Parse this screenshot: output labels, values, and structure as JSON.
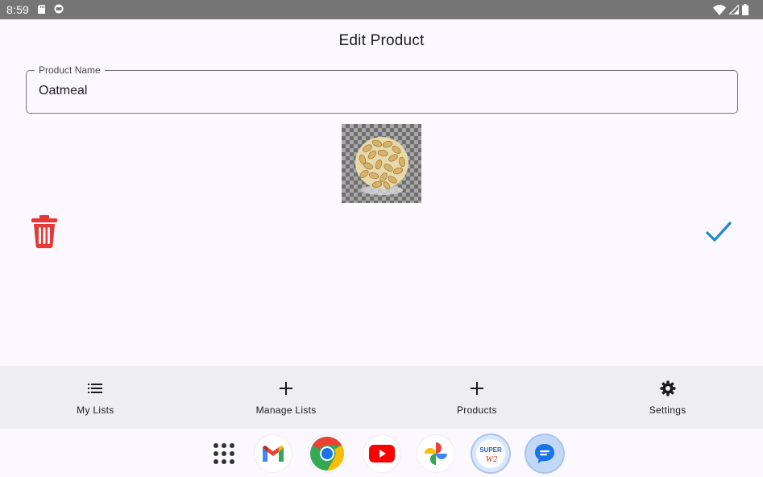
{
  "status_bar": {
    "time": "8:59"
  },
  "header": {
    "title": "Edit Product"
  },
  "form": {
    "product_name_label": "Product Name",
    "product_name_value": "Oatmeal"
  },
  "product_image": {
    "alt": "Oatmeal"
  },
  "actions": {
    "delete_icon": "trash-icon",
    "save_icon": "check-icon",
    "delete_color": "#e53935",
    "save_color": "#1e88c8"
  },
  "bottom_nav": {
    "items": [
      {
        "label": "My Lists",
        "icon": "list-icon"
      },
      {
        "label": "Manage Lists",
        "icon": "plus-icon"
      },
      {
        "label": "Products",
        "icon": "plus-icon"
      },
      {
        "label": "Settings",
        "icon": "gear-icon"
      }
    ]
  },
  "dock": {
    "apps": [
      {
        "name": "app-drawer",
        "icon": "grid-icon"
      },
      {
        "name": "gmail",
        "icon": "gmail-icon"
      },
      {
        "name": "chrome",
        "icon": "chrome-icon"
      },
      {
        "name": "youtube",
        "icon": "youtube-icon"
      },
      {
        "name": "photos",
        "icon": "photos-icon"
      },
      {
        "name": "super-w2",
        "icon": "super-w2-icon",
        "text_super": "SUPER",
        "text_w2": "W2"
      },
      {
        "name": "messages",
        "icon": "messages-icon"
      }
    ]
  }
}
